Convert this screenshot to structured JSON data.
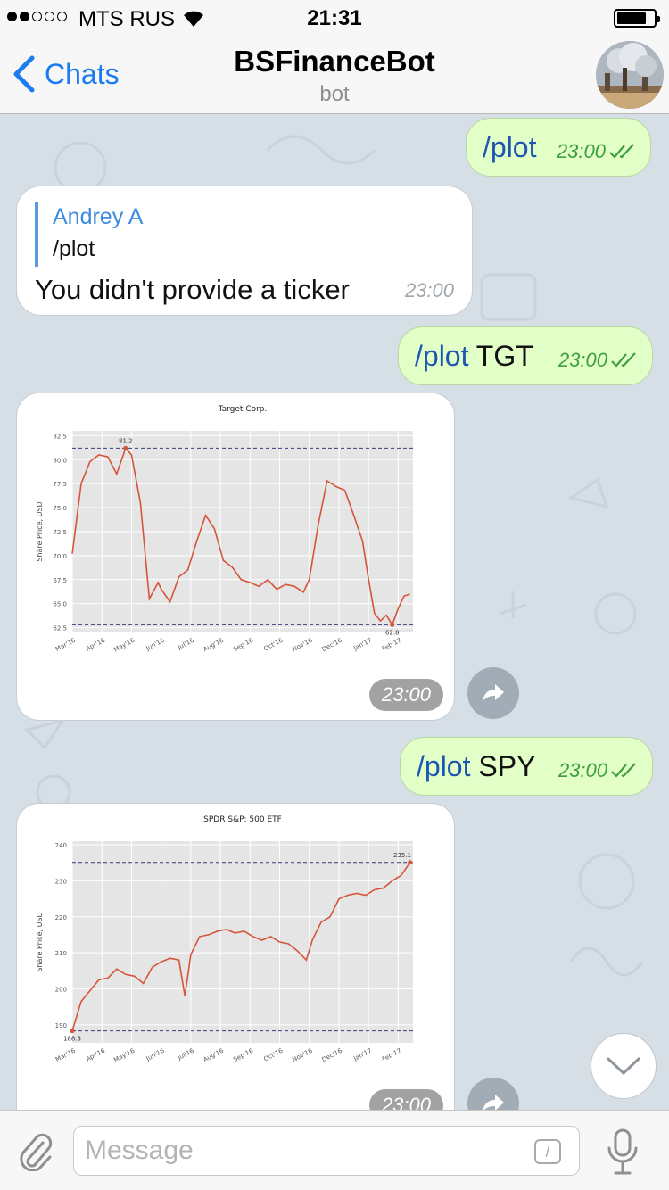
{
  "status_bar": {
    "signal_bars": 5,
    "signal_filled": 2,
    "carrier": "MTS RUS",
    "time": "21:31"
  },
  "header": {
    "back_label": "Chats",
    "title": "BSFinanceBot",
    "subtitle": "bot"
  },
  "colors": {
    "accent": "#1a7cf0",
    "outgoing_bubble": "#e1ffc7",
    "command_link": "#1d55b0",
    "plot_line": "#d4553a",
    "read_check": "#3f9f3f"
  },
  "messages": [
    {
      "direction": "out",
      "command": "/plot",
      "arg": "",
      "time": "23:00",
      "status": "read-double-check-icon"
    },
    {
      "direction": "in",
      "reply_to": {
        "name": "Andrey A",
        "text": "/plot"
      },
      "text": "You didn't provide a ticker",
      "time": "23:00"
    },
    {
      "direction": "out",
      "command": "/plot",
      "arg": " TGT",
      "time": "23:00",
      "status": "read-double-check-icon"
    },
    {
      "direction": "in",
      "type": "photo",
      "time": "23:00"
    },
    {
      "direction": "out",
      "command": "/plot",
      "arg": " SPY",
      "time": "23:00",
      "status": "read-double-check-icon"
    },
    {
      "direction": "in",
      "type": "photo",
      "time": "23:00"
    }
  ],
  "chart_data": [
    {
      "type": "line",
      "title": "Target Corp.",
      "ylabel": "Share Price, USD",
      "xlabel": "",
      "ylim": [
        62,
        83
      ],
      "yticks": [
        "62.5",
        "65.0",
        "67.5",
        "70.0",
        "72.5",
        "75.0",
        "77.5",
        "80.0",
        "82.5"
      ],
      "xticks": [
        "Mar'16",
        "Apr'16",
        "May'16",
        "Jun'16",
        "Jul'16",
        "Aug'16",
        "Sep'16",
        "Oct'16",
        "Nov'16",
        "Dec'16",
        "Jan'17",
        "Feb'17"
      ],
      "grid": true,
      "annotations": [
        {
          "label": "81.2",
          "value": 81.2,
          "kind": "max"
        },
        {
          "label": "62.8",
          "value": 62.8,
          "kind": "min"
        }
      ],
      "series": [
        {
          "x": [
            0,
            0.3,
            0.6,
            0.9,
            1.2,
            1.5,
            1.8,
            2.0,
            2.3,
            2.6,
            2.9,
            3.0,
            3.3,
            3.6,
            3.9,
            4.2,
            4.5,
            4.8,
            5.1,
            5.4,
            5.7,
            6.0,
            6.3,
            6.6,
            6.9,
            7.2,
            7.5,
            7.8,
            8.0,
            8.3,
            8.6,
            8.9,
            9.2,
            9.5,
            9.8,
            10.0,
            10.2,
            10.4,
            10.6,
            10.8,
            11.0,
            11.2,
            11.4
          ],
          "values": [
            70.2,
            77.5,
            79.8,
            80.5,
            80.3,
            78.5,
            81.2,
            80.5,
            75.5,
            65.5,
            67.2,
            66.5,
            65.2,
            67.8,
            68.5,
            71.5,
            74.2,
            72.8,
            69.5,
            68.8,
            67.5,
            67.2,
            66.8,
            67.5,
            66.5,
            67.0,
            66.8,
            66.2,
            67.5,
            73.2,
            77.8,
            77.2,
            76.8,
            74.2,
            71.5,
            67.5,
            64.0,
            63.2,
            63.8,
            62.8,
            64.5,
            65.8,
            66.0
          ]
        }
      ]
    },
    {
      "type": "line",
      "title": "SPDR S&P; 500 ETF",
      "ylabel": "Share Price, USD",
      "xlabel": "",
      "ylim": [
        185,
        241
      ],
      "yticks": [
        "190",
        "200",
        "210",
        "220",
        "230",
        "240"
      ],
      "xticks": [
        "Mar'16",
        "Apr'16",
        "May'16",
        "Jun'16",
        "Jul'16",
        "Aug'16",
        "Sep'16",
        "Oct'16",
        "Nov'16",
        "Dec'16",
        "Jan'17",
        "Feb'17"
      ],
      "grid": true,
      "annotations": [
        {
          "label": "235.1",
          "value": 235.1,
          "kind": "max"
        },
        {
          "label": "188.3",
          "value": 188.3,
          "kind": "min"
        }
      ],
      "series": [
        {
          "x": [
            0,
            0.3,
            0.6,
            0.9,
            1.2,
            1.5,
            1.8,
            2.1,
            2.4,
            2.7,
            3.0,
            3.3,
            3.6,
            3.8,
            4.0,
            4.3,
            4.6,
            4.9,
            5.2,
            5.5,
            5.8,
            6.1,
            6.4,
            6.7,
            7.0,
            7.3,
            7.6,
            7.9,
            8.1,
            8.4,
            8.7,
            9.0,
            9.3,
            9.6,
            9.9,
            10.2,
            10.5,
            10.8,
            11.1,
            11.4
          ],
          "values": [
            188.3,
            196.5,
            199.5,
            202.5,
            203.0,
            205.5,
            204.0,
            203.5,
            201.5,
            206.0,
            207.5,
            208.5,
            208.0,
            198.0,
            209.5,
            214.5,
            215.0,
            216.0,
            216.5,
            215.5,
            216.0,
            214.5,
            213.5,
            214.5,
            213.0,
            212.5,
            210.5,
            208.0,
            213.5,
            218.5,
            220.0,
            225.0,
            226.0,
            226.5,
            226.0,
            227.5,
            228.0,
            230.0,
            231.5,
            235.1
          ]
        }
      ]
    }
  ],
  "input": {
    "placeholder": "Message",
    "bot_command_key": "/"
  }
}
